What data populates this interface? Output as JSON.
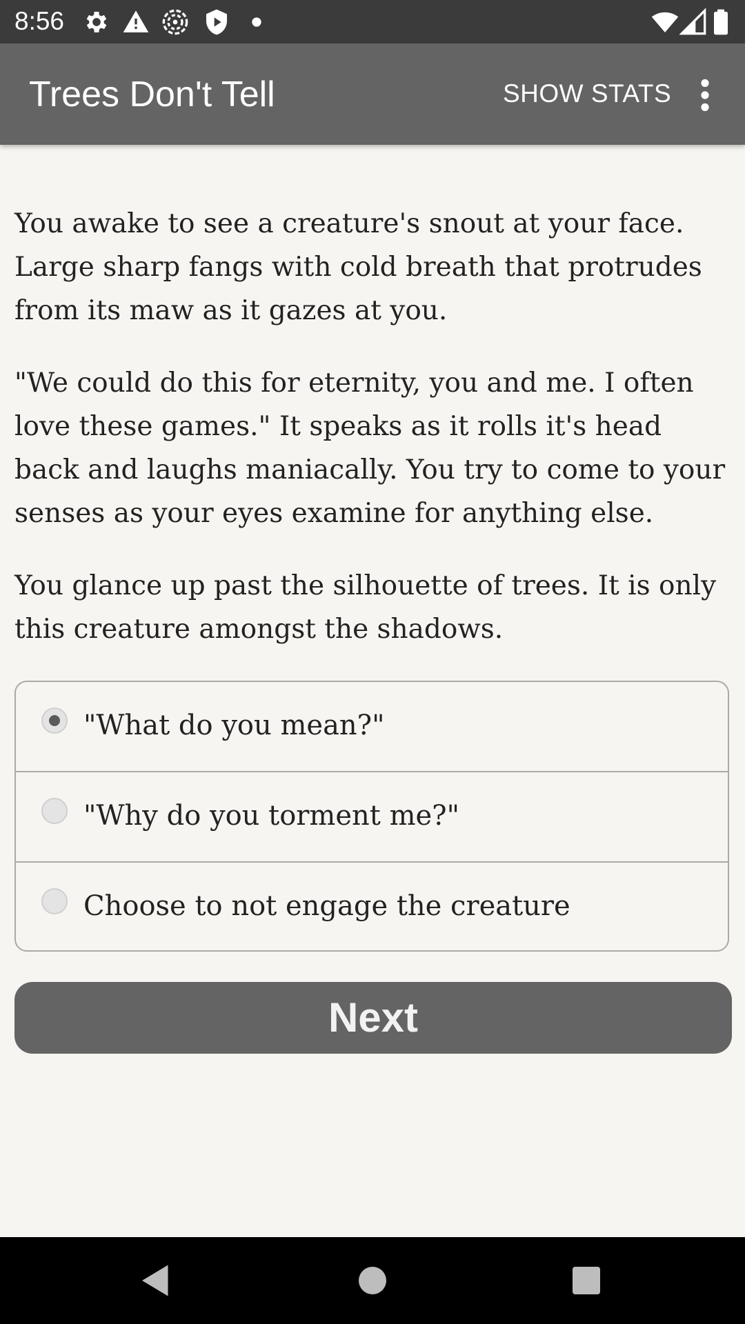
{
  "status_bar": {
    "time": "8:56",
    "icons": [
      "gear-icon",
      "warning-icon",
      "radar-icon",
      "shield-icon",
      "dot-icon",
      "wifi-icon",
      "signal-icon",
      "battery-icon"
    ]
  },
  "app_bar": {
    "title": "Trees Don't Tell",
    "show_stats_label": "SHOW STATS",
    "overflow_icon": "more-vert-icon"
  },
  "story": {
    "paragraphs": [
      "You awake to see a creature's snout at your face. Large sharp fangs with cold breath that protrudes from its maw as it gazes at you.",
      "\"We could do this for eternity, you and me. I often love these games.\" It speaks as it rolls it's head back and laughs maniacally. You try to come to your senses as your eyes examine for anything else.",
      "You glance up past the silhouette of trees. It is only this creature amongst the shadows."
    ]
  },
  "choices": {
    "options": [
      {
        "label": "\"What do you mean?\"",
        "selected": true
      },
      {
        "label": "\"Why do you torment me?\"",
        "selected": false
      },
      {
        "label": "Choose to not engage the creature",
        "selected": false
      }
    ]
  },
  "next_button": {
    "label": "Next"
  },
  "nav_bar": {
    "icons": [
      "back-icon",
      "home-icon",
      "recents-icon"
    ]
  },
  "colors": {
    "app_bar": "#646464",
    "status_bar": "#3b3b3b",
    "background": "#f7f5f1",
    "button": "#646464"
  }
}
